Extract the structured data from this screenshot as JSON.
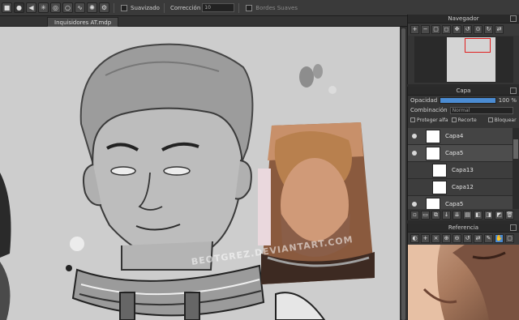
{
  "toolbar": {
    "antialias_label": "Suavizado",
    "correction_label": "Corrección",
    "correction_value": "10",
    "soft_edges_label": "Bordes Suaves"
  },
  "document": {
    "tab_title": "Inquisidores AT.mdp"
  },
  "canvas": {
    "watermark": "BEOTGREZ.DEVIANTART.COM"
  },
  "navigator": {
    "title": "Navegador"
  },
  "layer_panel": {
    "title": "Capa",
    "opacity_label": "Opacidad",
    "opacity_value": "100 %",
    "blend_label": "Combinación",
    "blend_value": "Normal",
    "protect_alpha_label": "Proteger alfa",
    "clipping_label": "Recorte",
    "lock_label": "Bloquear",
    "layers": [
      {
        "name": "Capa4"
      },
      {
        "name": "Capa5"
      },
      {
        "name": "Capa13"
      },
      {
        "name": "Capa12"
      },
      {
        "name": "Capa5"
      }
    ]
  },
  "reference_panel": {
    "title": "Referencia"
  },
  "colors": {
    "accent": "#4b8cd3",
    "nav_rect": "#e02020"
  }
}
